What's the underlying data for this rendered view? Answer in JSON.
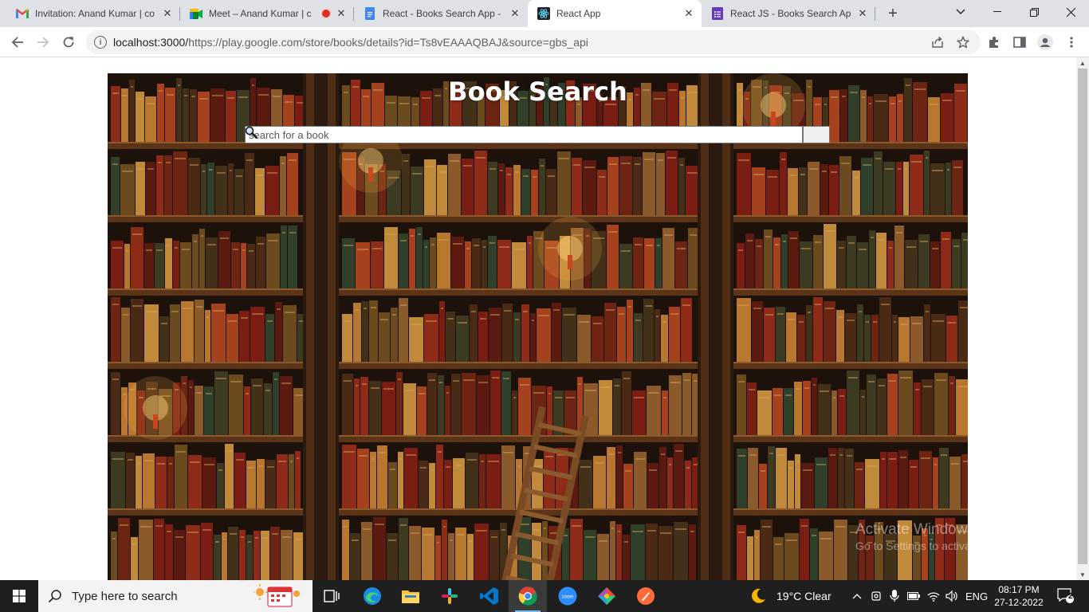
{
  "browser": {
    "tabs": [
      {
        "title": "Invitation: Anand Kumar | co",
        "icon": "gmail-icon"
      },
      {
        "title": "Meet – Anand Kumar | c",
        "icon": "meet-icon",
        "recording": true
      },
      {
        "title": "React - Books Search App - C",
        "icon": "docs-icon"
      },
      {
        "title": "React App",
        "icon": "react-icon",
        "active": true
      },
      {
        "title": "React JS - Books Search App",
        "icon": "forms-icon"
      }
    ],
    "url_host": "localhost:3000/",
    "url_rest": "https://play.google.com/store/books/details?id=Ts8vEAAAQBAJ&source=gbs_api"
  },
  "page": {
    "title": "Book Search",
    "search_placeholder": "search for a book",
    "search_button_icon": "magnifier-icon"
  },
  "watermark": {
    "line1": "Activate Windows",
    "line2": "Go to Settings to activate Windows."
  },
  "taskbar": {
    "search_placeholder": "Type here to search",
    "weather": "19°C  Clear",
    "language": "ENG",
    "time": "08:17 PM",
    "date": "27-12-2022",
    "notifications": "2"
  },
  "colors": {
    "tabstrip": "#dee1e6",
    "taskbar": "#1f1f1f",
    "hero_wood": "#3a1f0e"
  }
}
